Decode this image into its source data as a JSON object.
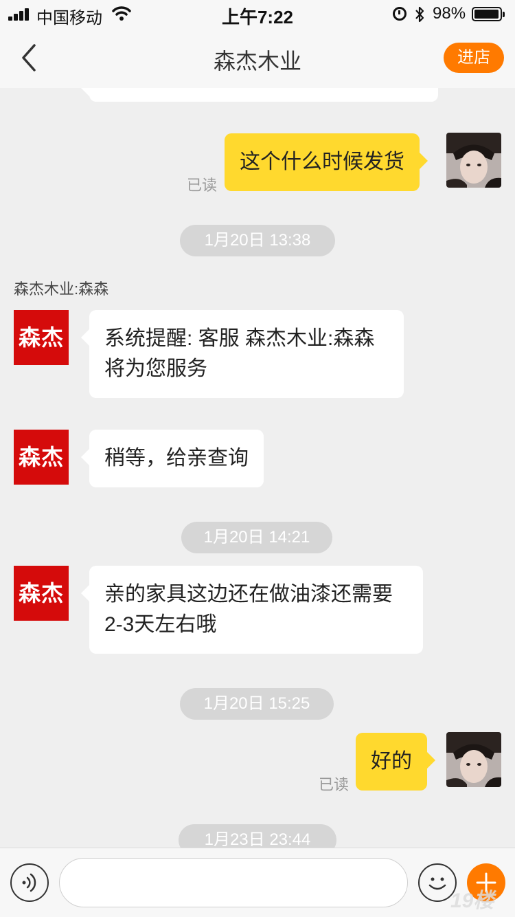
{
  "statusbar": {
    "carrier": "中国移动",
    "time": "上午7:22",
    "battery_percent": "98%",
    "battery_level": 0.98,
    "bluetooth_icon": "bluetooth-icon"
  },
  "navbar": {
    "title": "森杰木业",
    "back_icon": "chevron-left-icon",
    "store_button": "进店"
  },
  "chat": {
    "messages": [
      {
        "side": "out",
        "text": "这个什么时候发货",
        "read": "已读"
      },
      {
        "type": "time",
        "text": "1月20日 13:38"
      },
      {
        "type": "sender",
        "text": "森杰木业:森森"
      },
      {
        "side": "in",
        "text_line1": "系统提醒: 客服 森杰木业:森森",
        "text_line2": "将为您服务"
      },
      {
        "side": "in",
        "text": "稍等，给亲查询"
      },
      {
        "type": "time",
        "text": "1月20日 14:21"
      },
      {
        "side": "in",
        "text_line1": "亲的家具这边还在做油漆还需要",
        "text_line2": "2-3天左右哦"
      },
      {
        "type": "time",
        "text": "1月20日 15:25"
      },
      {
        "side": "out",
        "text": "好的",
        "read": "已读"
      },
      {
        "type": "time",
        "text": "1月23日 23:44"
      }
    ],
    "shop_avatar_text": "森杰"
  },
  "inputbar": {
    "input_value": "",
    "voice_icon": "voice-icon",
    "emoji_icon": "emoji-icon",
    "plus_icon": "plus-icon"
  },
  "watermark": "19楼",
  "colors": {
    "accent_orange": "#ff7a00",
    "bubble_yellow": "#ffd92e",
    "shop_red": "#d50b0b"
  }
}
